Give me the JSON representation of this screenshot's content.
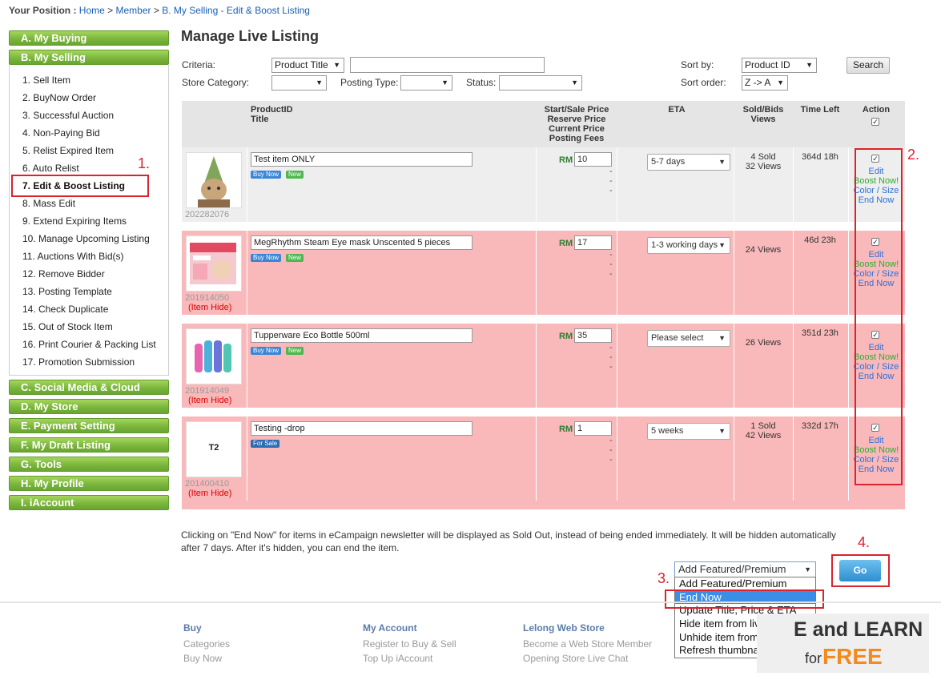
{
  "breadcrumb": {
    "label": "Your Position :",
    "home": "Home",
    "member": "Member",
    "current": "B. My Selling - Edit & Boost Listing",
    "sep": ">"
  },
  "sidebar": {
    "sections_top": [
      "A. My Buying",
      "B. My Selling"
    ],
    "selling_items": [
      "1. Sell Item",
      "2. BuyNow Order",
      "3. Successful Auction",
      "4. Non-Paying Bid",
      "5. Relist Expired Item",
      "6. Auto Relist",
      "7. Edit & Boost Listing",
      "8. Mass Edit",
      "9. Extend Expiring Items",
      "10. Manage Upcoming Listing",
      "11. Auctions With Bid(s)",
      "12. Remove Bidder",
      "13. Posting Template",
      "14. Check Duplicate",
      "15. Out of Stock Item",
      "16. Print Courier & Packing List",
      "17. Promotion Submission"
    ],
    "sections_bottom": [
      "C. Social Media & Cloud",
      "D. My Store",
      "E. Payment Setting",
      "F. My Draft Listing",
      "G. Tools",
      "H. My Profile",
      "I. iAccount"
    ]
  },
  "annotations": {
    "n1": "1.",
    "n2": "2.",
    "n3": "3.",
    "n4": "4."
  },
  "page_title": "Manage Live Listing",
  "filters": {
    "criteria_label": "Criteria:",
    "criteria_value": "Product Title",
    "store_category_label": "Store Category:",
    "posting_type_label": "Posting Type:",
    "status_label": "Status:",
    "sort_by_label": "Sort by:",
    "sort_by_value": "Product ID",
    "sort_order_label": "Sort order:",
    "sort_order_value": "Z -> A",
    "search_button": "Search"
  },
  "table": {
    "headers": {
      "product": [
        "ProductID",
        "Title"
      ],
      "price": [
        "Start/Sale Price",
        "Reserve Price",
        "Current Price",
        "Posting Fees"
      ],
      "eta": "ETA",
      "sold": [
        "Sold/Bids",
        "Views"
      ],
      "time_left": "Time Left",
      "action": "Action"
    },
    "currency": "RM",
    "dash": "-",
    "actions": {
      "edit": "Edit",
      "boost": "Boost Now!",
      "color": "Color / Size",
      "end": "End Now"
    },
    "rows": [
      {
        "id": "202282076",
        "title": "Test item ONLY",
        "badges": [
          "Buy Now",
          "New"
        ],
        "price": "10",
        "eta": "5-7 days",
        "sold": "4 Sold",
        "views": "32 Views",
        "time_left": "364d 18h",
        "hidden": "",
        "thumb_label": ""
      },
      {
        "id": "201914050",
        "title": "MegRhythm Steam Eye mask Unscented 5 pieces",
        "badges": [
          "Buy Now",
          "New"
        ],
        "price": "17",
        "eta": "1-3 working days",
        "sold": "",
        "views": "24 Views",
        "time_left": "46d 23h",
        "hidden": "(Item Hide)",
        "thumb_label": ""
      },
      {
        "id": "201914049",
        "title": "Tupperware Eco Bottle 500ml",
        "badges": [
          "Buy Now",
          "New"
        ],
        "price": "35",
        "eta": "Please select",
        "sold": "",
        "views": "26 Views",
        "time_left": "351d 23h",
        "hidden": "(Item Hide)",
        "thumb_label": ""
      },
      {
        "id": "201400410",
        "title": "Testing -drop",
        "badges": [
          "For Sale"
        ],
        "price": "1",
        "eta": "5 weeks",
        "sold": "1 Sold",
        "views": "42 Views",
        "time_left": "332d 17h",
        "hidden": "(Item Hide)",
        "thumb_label": "T2"
      }
    ]
  },
  "note": "Clicking on \"End Now\" for items in eCampaign newsletter will be displayed as Sold Out, instead of being ended immediately. It will be hidden automatically after 7 days. After it's hidden, you can end the item.",
  "bulk_action": {
    "selected": "Add Featured/Premium",
    "options": [
      "Add Featured/Premium",
      "End Now",
      "Update Title, Price & ETA",
      "Hide item from live",
      "Unhide item from live",
      "Refresh thumbnail"
    ],
    "go": "Go"
  },
  "footer": {
    "col1": {
      "head": "Buy",
      "links": [
        "Categories",
        "Buy Now"
      ]
    },
    "col2": {
      "head": "My Account",
      "links": [
        "Register to Buy & Sell",
        "Top Up iAccount"
      ]
    },
    "col3": {
      "head": "Lelong Web Store",
      "links": [
        "Become a Web Store Member",
        "Opening Store Live Chat"
      ]
    },
    "banner": {
      "line1": "E and LEARN",
      "line2a": "for",
      "line2b": "FREE"
    }
  },
  "colors": {
    "accent_red": "#d9232d",
    "sidebar_green": "#78b43a",
    "row_hidden": "#f9b9ba",
    "row_normal": "#eeeeee",
    "link_blue": "#1a5fb4"
  }
}
